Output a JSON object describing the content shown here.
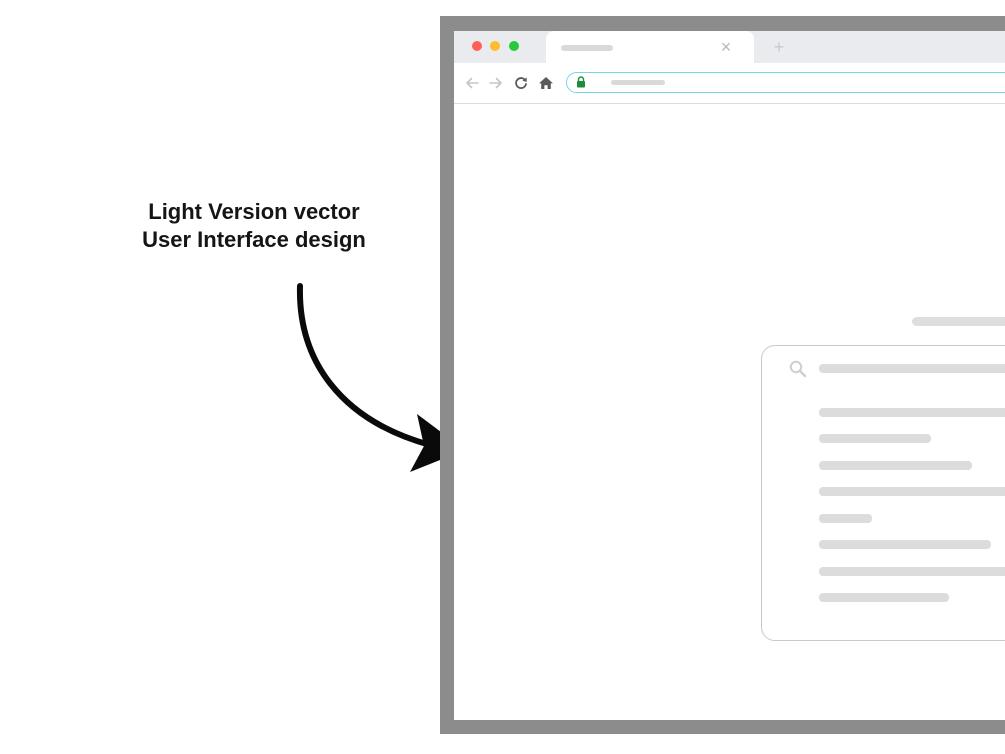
{
  "caption": {
    "line1": "Light Version vector",
    "line2": "User Interface design"
  },
  "browser": {
    "tab_close_glyph": "×",
    "new_tab_glyph": "+",
    "traffic_light_colors": {
      "close": "#ff5f57",
      "minimize": "#febc2e",
      "zoom": "#28c840"
    },
    "address_bar_border_color": "#79d5e6",
    "lock_color": "#1e8c3a"
  },
  "icons": [
    "back-arrow-icon",
    "forward-arrow-icon",
    "reload-icon",
    "home-icon",
    "lock-icon",
    "search-icon",
    "curved-arrow-icon"
  ]
}
